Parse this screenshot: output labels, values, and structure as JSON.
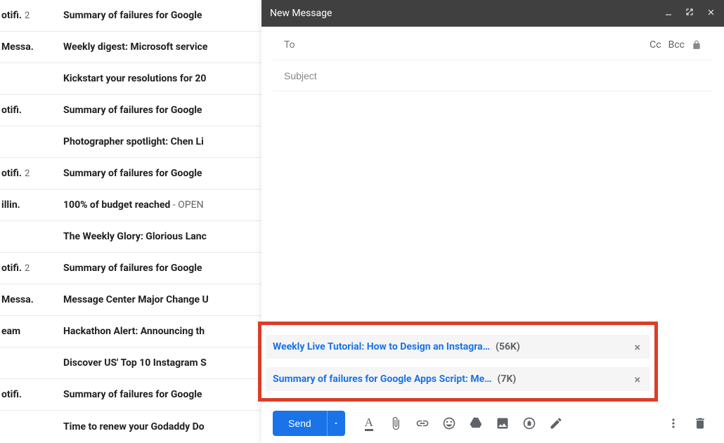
{
  "emails": [
    {
      "sender": "otifi.",
      "count": "2",
      "subject": "Summary of failures for Google "
    },
    {
      "sender": "Messa.",
      "count": "",
      "subject": "Weekly digest: Microsoft service"
    },
    {
      "sender": "",
      "count": "",
      "subject": "Kickstart your resolutions for 20"
    },
    {
      "sender": "otifi.",
      "count": "",
      "subject": "Summary of failures for Google "
    },
    {
      "sender": "",
      "count": "",
      "subject": "Photographer spotlight: Chen Li"
    },
    {
      "sender": "otifi.",
      "count": "2",
      "subject": "Summary of failures for Google "
    },
    {
      "sender": "illin.",
      "count": "",
      "subject": "100% of budget reached",
      "snippet": " - OPEN"
    },
    {
      "sender": "",
      "count": "",
      "subject": "The Weekly Glory: Glorious Lanc"
    },
    {
      "sender": "otifi.",
      "count": "2",
      "subject": "Summary of failures for Google "
    },
    {
      "sender": "Messa.",
      "count": "",
      "subject": "Message Center Major Change U"
    },
    {
      "sender": "eam",
      "count": "",
      "subject": "Hackathon Alert: Announcing th"
    },
    {
      "sender": "",
      "count": "",
      "subject": "Discover US' Top 10 Instagram S"
    },
    {
      "sender": "otifi.",
      "count": "",
      "subject": "Summary of failures for Google "
    },
    {
      "sender": "",
      "count": "",
      "subject": "Time to renew your Godaddy Do"
    }
  ],
  "compose": {
    "title": "New Message",
    "to_label": "To",
    "cc": "Cc",
    "bcc": "Bcc",
    "subject_placeholder": "Subject",
    "send_label": "Send",
    "attachments": [
      {
        "name": "Weekly Live Tutorial: How to Design an Instagra…",
        "size": "(56K)"
      },
      {
        "name": "Summary of failures for Google Apps Script: Me…",
        "size": "(7K)"
      }
    ]
  }
}
